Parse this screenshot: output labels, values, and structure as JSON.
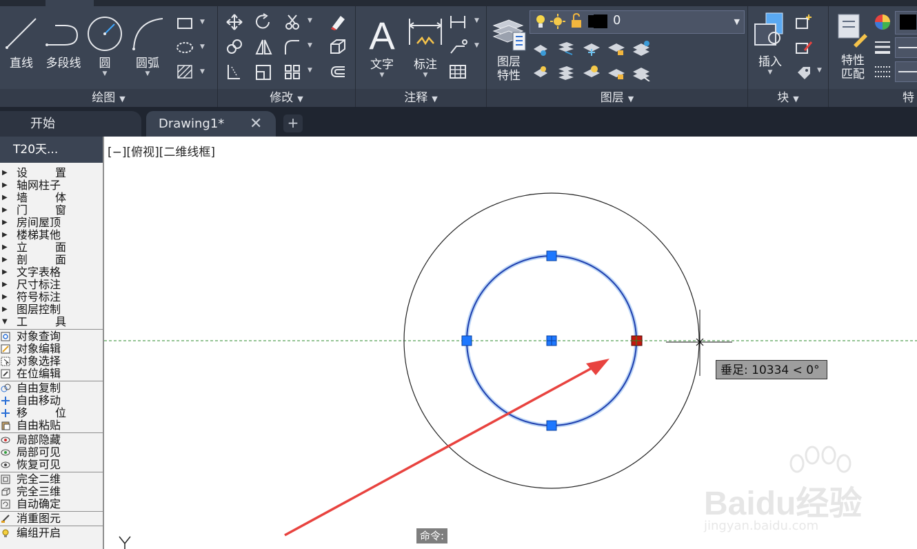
{
  "ribbon": {
    "panels": {
      "draw": {
        "title": "绘图",
        "line": "直线",
        "polyline": "多段线",
        "circle": "圆",
        "arc": "圆弧"
      },
      "modify": {
        "title": "修改"
      },
      "annotation": {
        "title": "注释",
        "text": "文字",
        "dimension": "标注"
      },
      "layers": {
        "title": "图层",
        "layer_properties": "图层\n特性",
        "current_layer": "0"
      },
      "block": {
        "title": "块",
        "insert": "插入"
      },
      "properties": {
        "match": "特性\n匹配",
        "title_partial": "特"
      }
    }
  },
  "file_tabs": {
    "start": "开始",
    "drawing": "Drawing1*",
    "close_glyph": "✕",
    "add_glyph": "+"
  },
  "palette": {
    "header": "T20天...",
    "menu_items": [
      [
        "设",
        "置"
      ],
      [
        "轴网柱子"
      ],
      [
        "墙",
        "体"
      ],
      [
        "门",
        "窗"
      ],
      [
        "房间屋顶"
      ],
      [
        "楼梯其他"
      ],
      [
        "立",
        "面"
      ],
      [
        "剖",
        "面"
      ],
      [
        "文字表格"
      ],
      [
        "尺寸标注"
      ],
      [
        "符号标注"
      ],
      [
        "图层控制"
      ],
      [
        "工",
        "具"
      ]
    ],
    "group1": [
      "对象查询",
      "对象编辑",
      "对象选择",
      "在位编辑"
    ],
    "group2": [
      [
        "自由复制"
      ],
      [
        "自由移动"
      ],
      [
        "移",
        "位"
      ],
      [
        "自由粘贴"
      ]
    ],
    "group3": [
      "局部隐藏",
      "局部可见",
      "恢复可见"
    ],
    "group4": [
      "完全二维",
      "完全三维",
      "自动确定"
    ],
    "group5": [
      "消重图元"
    ],
    "group6": [
      "编组开启"
    ]
  },
  "canvas": {
    "viewport_label": "[−][俯视][二维线框]",
    "tooltip": "垂足: 10334 < 0°",
    "command_label": "命令:",
    "ucs_label": "Y"
  },
  "watermark": {
    "brand": "Baidu经验",
    "url": "jingyan.baidu.com"
  },
  "colors": {
    "ribbon_bg": "#3b4453",
    "selection_blue": "#1f5bd6",
    "grip_blue": "#1e78ff",
    "grip_hot": "#c4160f",
    "arrow_red": "#e8433f",
    "tracking_green": "#2a8a2a"
  }
}
